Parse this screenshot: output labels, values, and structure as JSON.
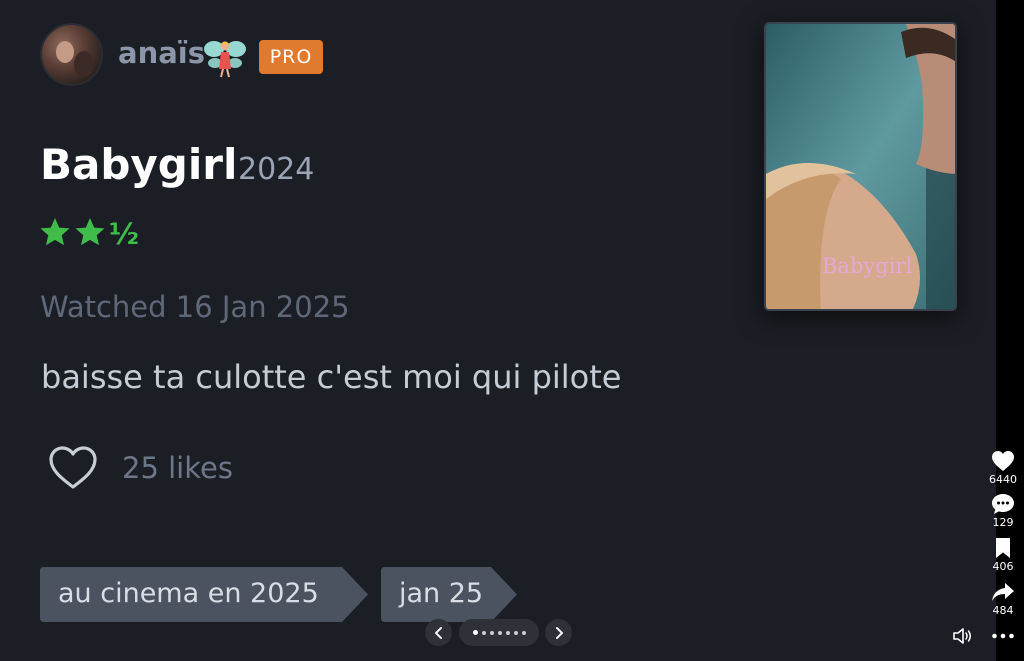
{
  "user": {
    "name": "anaïs",
    "badge": "PRO",
    "emoji_icon": "fairy-icon"
  },
  "film": {
    "title": "Babygirl",
    "year": "2024",
    "rating_stars": 2.5,
    "poster_title": "Babygirl"
  },
  "review": {
    "watched_label": "Watched 16 Jan 2025",
    "text": "baisse ta culotte c'est moi qui pilote",
    "likes_label": "25 likes"
  },
  "tags": [
    "au cinema en 2025",
    "jan 25"
  ],
  "carousel": {
    "dot_count": 7,
    "active_index": 0
  },
  "actions": {
    "likes": "6440",
    "comments": "129",
    "saves": "406",
    "shares": "484"
  },
  "colors": {
    "background": "#1b1e24",
    "accent_pro": "#e07a2f",
    "star_green": "#40bc4a",
    "tag_bg": "#4b5361"
  }
}
